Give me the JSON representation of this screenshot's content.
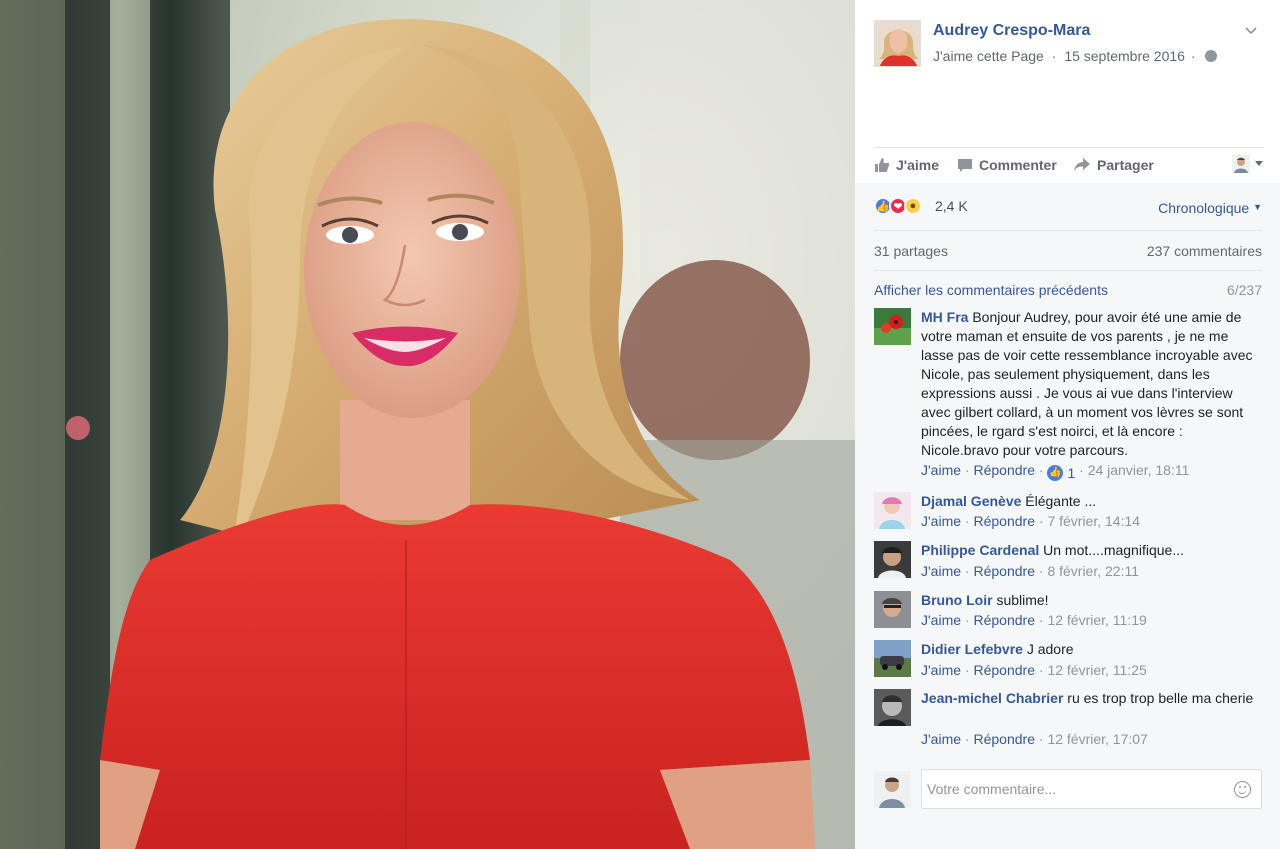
{
  "post": {
    "page_name": "Audrey Crespo-Mara",
    "like_page": "J'aime cette Page",
    "date": "15 septembre 2016",
    "sep": "·"
  },
  "actions": {
    "like": "J'aime",
    "comment": "Commenter",
    "share": "Partager"
  },
  "reactions": {
    "count": "2,4 K",
    "sort": "Chronologique"
  },
  "stats": {
    "shares": "31 partages",
    "comments": "237 commentaires"
  },
  "previous": {
    "label": "Afficher les commentaires précédents",
    "count": "6/237"
  },
  "comments": [
    {
      "author": "MH Fra",
      "text": "Bonjour Audrey, pour avoir été une amie de votre maman et ensuite de vos parents , je ne me lasse pas de voir cette ressemblance incroyable avec Nicole, pas seulement physiquement, dans les expressions aussi . Je vous ai vue dans l'interview avec gilbert collard, à un moment vos lèvres se sont pincées, le rgard s'est noirci, et là encore : Nicole.bravo pour votre parcours.",
      "like": "J'aime",
      "reply": "Répondre",
      "likes": "1",
      "time": "24 janvier, 18:11"
    },
    {
      "author": "Djamal Genève",
      "text": "Élégante ...",
      "like": "J'aime",
      "reply": "Répondre",
      "time": "7 février, 14:14"
    },
    {
      "author": "Philippe Cardenal",
      "text": "Un mot....magnifique...",
      "like": "J'aime",
      "reply": "Répondre",
      "time": "8 février, 22:11"
    },
    {
      "author": "Bruno Loir",
      "text": "sublime!",
      "like": "J'aime",
      "reply": "Répondre",
      "time": "12 février, 11:19"
    },
    {
      "author": "Didier Lefebvre",
      "text": "J adore",
      "like": "J'aime",
      "reply": "Répondre",
      "time": "12 février, 11:25"
    },
    {
      "author": "Jean-michel Chabrier",
      "text": "ru es trop trop belle ma cherie",
      "like": "J'aime",
      "reply": "Répondre",
      "time": "12 février, 17:07"
    }
  ],
  "composer": {
    "placeholder": "Votre commentaire..."
  },
  "colors": {
    "link": "#365899",
    "dress": "#e0312c",
    "hair": "#d9b47e"
  }
}
